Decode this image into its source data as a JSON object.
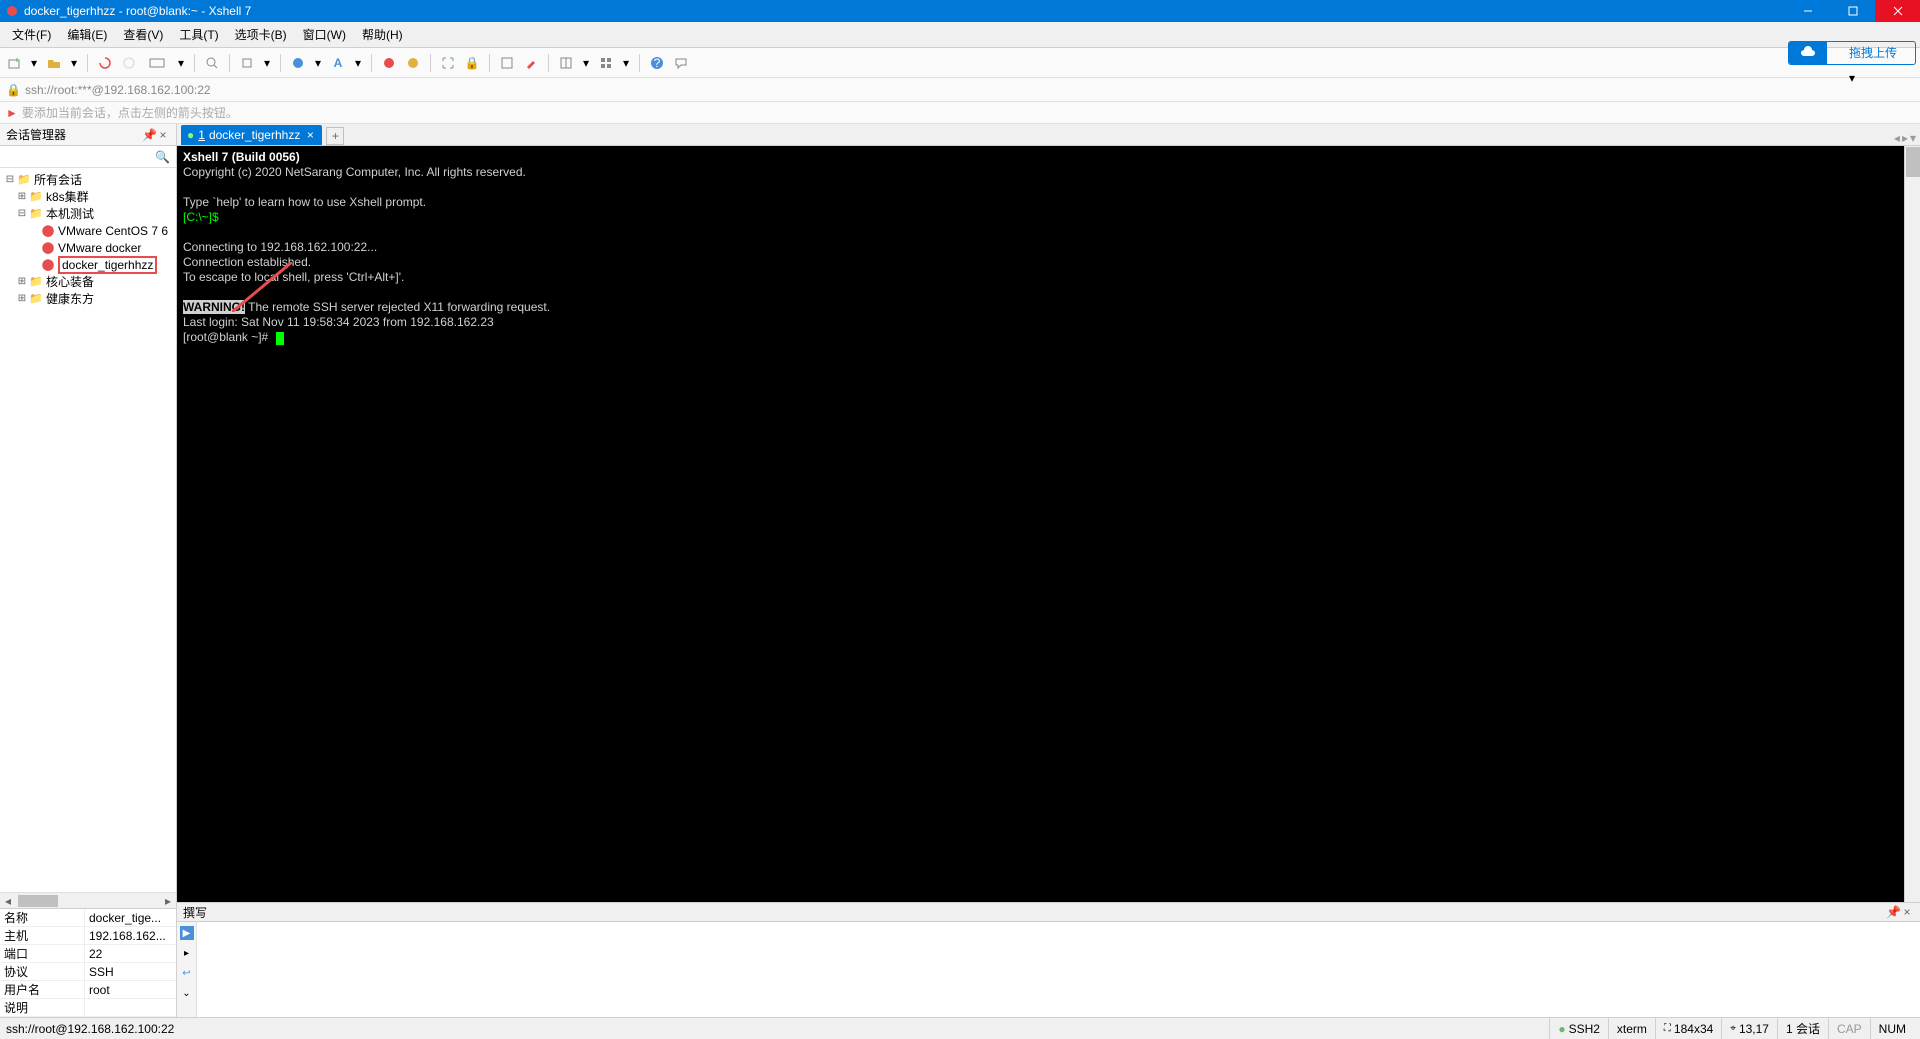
{
  "window": {
    "title": "docker_tigerhhzz - root@blank:~ - Xshell 7"
  },
  "menu": {
    "file": "文件(F)",
    "edit": "编辑(E)",
    "view": "查看(V)",
    "tools": "工具(T)",
    "tab": "选项卡(B)",
    "window": "窗口(W)",
    "help": "帮助(H)"
  },
  "upload_label": "拖拽上传",
  "addressbar": "ssh://root:***@192.168.162.100:22",
  "hintbar": "要添加当前会话，点击左侧的箭头按钮。",
  "session_panel": {
    "title": "会话管理器",
    "tree": {
      "root": "所有会话",
      "k8s": "k8s集群",
      "localtest": "本机测试",
      "vm_centos": "VMware CentOS 7 6",
      "vm_docker": "VMware docker",
      "docker_tiger": "docker_tigerhhzz",
      "core": "核心装备",
      "health": "健康东方"
    },
    "props": {
      "name_k": "名称",
      "name_v": "docker_tige...",
      "host_k": "主机",
      "host_v": "192.168.162...",
      "port_k": "端口",
      "port_v": "22",
      "proto_k": "协议",
      "proto_v": "SSH",
      "user_k": "用户名",
      "user_v": "root",
      "desc_k": "说明",
      "desc_v": ""
    }
  },
  "tab": {
    "number": "1",
    "label": "docker_tigerhhzz"
  },
  "terminal": {
    "line1": "Xshell 7 (Build 0056)",
    "line2": "Copyright (c) 2020 NetSarang Computer, Inc. All rights reserved.",
    "line3": "Type `help' to learn how to use Xshell prompt.",
    "prompt_local": "[C:\\~]$",
    "line4": "Connecting to 192.168.162.100:22...",
    "line5": "Connection established.",
    "line6": "To escape to local shell, press 'Ctrl+Alt+]'.",
    "warn_label": "WARNING!",
    "warn_text": " The remote SSH server rejected X11 forwarding request.",
    "login": "Last login: Sat Nov 11 19:58:34 2023 from 192.168.162.23",
    "prompt_remote": "[root@blank ~]#"
  },
  "compose_title": "撰写",
  "statusbar": {
    "conn": "ssh://root@192.168.162.100:22",
    "ssh": "SSH2",
    "term": "xterm",
    "size": "184x34",
    "pos": "13,17",
    "sess": "1 会话",
    "cap": "CAP",
    "num": "NUM"
  }
}
